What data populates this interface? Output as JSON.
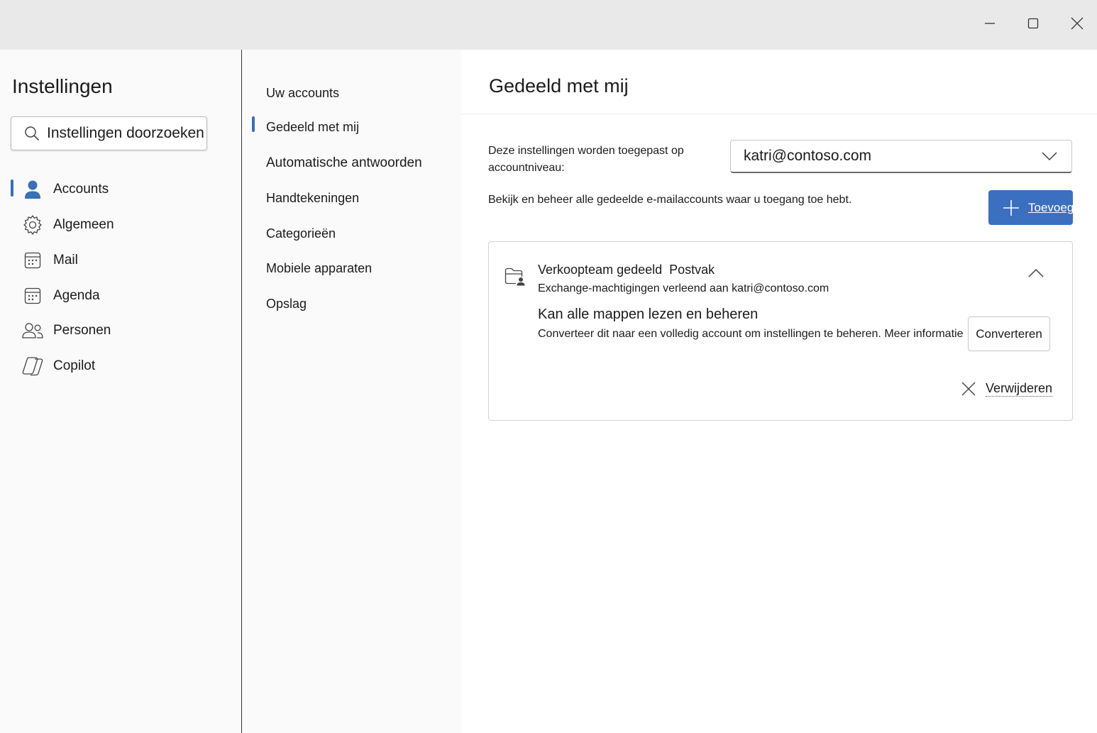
{
  "window_controls": {
    "minimize_icon": "minimize-icon",
    "maximize_icon": "maximize-icon",
    "close_icon": "close-icon"
  },
  "sidebar": {
    "title": "Instellingen",
    "search_placeholder": "Instellingen doorzoeken",
    "items": [
      {
        "label": "Accounts",
        "icon": "person-icon",
        "selected": true
      },
      {
        "label": "Algemeen",
        "icon": "gear-icon"
      },
      {
        "label": "Mail",
        "icon": "mail-icon"
      },
      {
        "label": "Agenda",
        "icon": "calendar-icon"
      },
      {
        "label": "Personen",
        "icon": "people-icon"
      },
      {
        "label": "Copilot",
        "icon": "copilot-icon"
      }
    ]
  },
  "subnav": {
    "items": [
      {
        "label": "Uw accounts"
      },
      {
        "label": "Gedeeld met mij",
        "selected": true
      },
      {
        "label": "Automatische antwoorden"
      },
      {
        "label": "Handtekeningen"
      },
      {
        "label": "Categorieën"
      },
      {
        "label": "Mobiele apparaten"
      },
      {
        "label": "Opslag"
      }
    ]
  },
  "main": {
    "title": "Gedeeld met mij",
    "apply_text": "Deze instellingen worden toegepast op accountniveau:",
    "account_select": "katri@contoso.com",
    "manage_text": "Bekijk en beheer alle gedeelde e-mailaccounts waar u toegang toe hebt.",
    "add_button": "Toevoegen",
    "shared_mailbox": {
      "name": "Verkoopteam gedeeld",
      "type": "Postvak",
      "permissions": "Exchange-machtigingen verleend aan katri@contoso.com",
      "access_title": "Kan alle mappen lezen en beheren",
      "convert_text": "Converteer dit naar een volledig account om instellingen te beheren.",
      "more_info": "Meer informatie",
      "convert_button": "Converteren",
      "remove_button": "Verwijderen"
    },
    "accent_color": "#3b6fc0"
  }
}
